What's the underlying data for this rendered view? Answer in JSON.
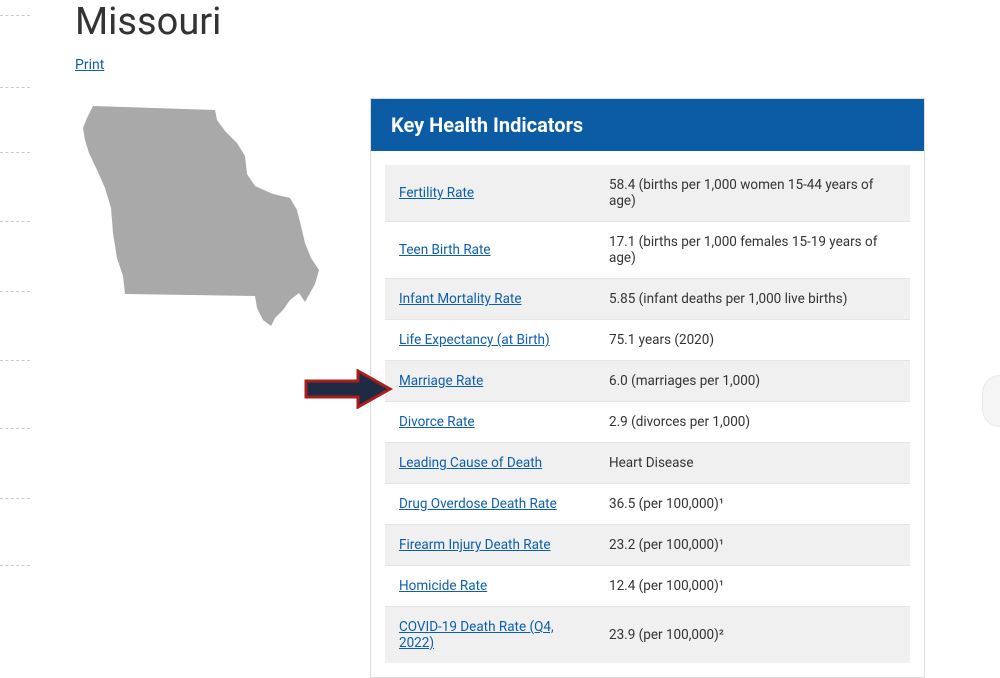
{
  "page": {
    "title": "Missouri",
    "print_label": "Print"
  },
  "panel": {
    "title": "Key Health Indicators"
  },
  "indicators": {
    "rows": [
      {
        "label": "Fertility Rate",
        "value": "58.4 (births per 1,000 women 15-44 years of age)"
      },
      {
        "label": "Teen Birth Rate",
        "value": "17.1 (births per 1,000 females 15-19 years of age)"
      },
      {
        "label": "Infant Mortality Rate",
        "value": "5.85 (infant deaths per 1,000 live births)"
      },
      {
        "label": "Life Expectancy (at Birth)",
        "value": "75.1 years (2020)"
      },
      {
        "label": "Marriage Rate",
        "value": "6.0 (marriages per 1,000)"
      },
      {
        "label": "Divorce Rate",
        "value": "2.9 (divorces per 1,000)"
      },
      {
        "label": "Leading Cause of Death",
        "value": "Heart Disease"
      },
      {
        "label": "Drug Overdose Death Rate",
        "value": "36.5 (per 100,000)¹"
      },
      {
        "label": "Firearm Injury Death Rate",
        "value": "23.2 (per 100,000)¹"
      },
      {
        "label": "Homicide Rate",
        "value": "12.4 (per 100,000)¹"
      },
      {
        "label": "COVID-19 Death Rate (Q4, 2022)",
        "value": "23.9 (per 100,000)²"
      }
    ]
  },
  "colors": {
    "header_bg": "#0b5ba5",
    "link": "#0d5eaf",
    "arrow_fill": "#1e2b43",
    "arrow_stroke": "#a81d1d"
  }
}
